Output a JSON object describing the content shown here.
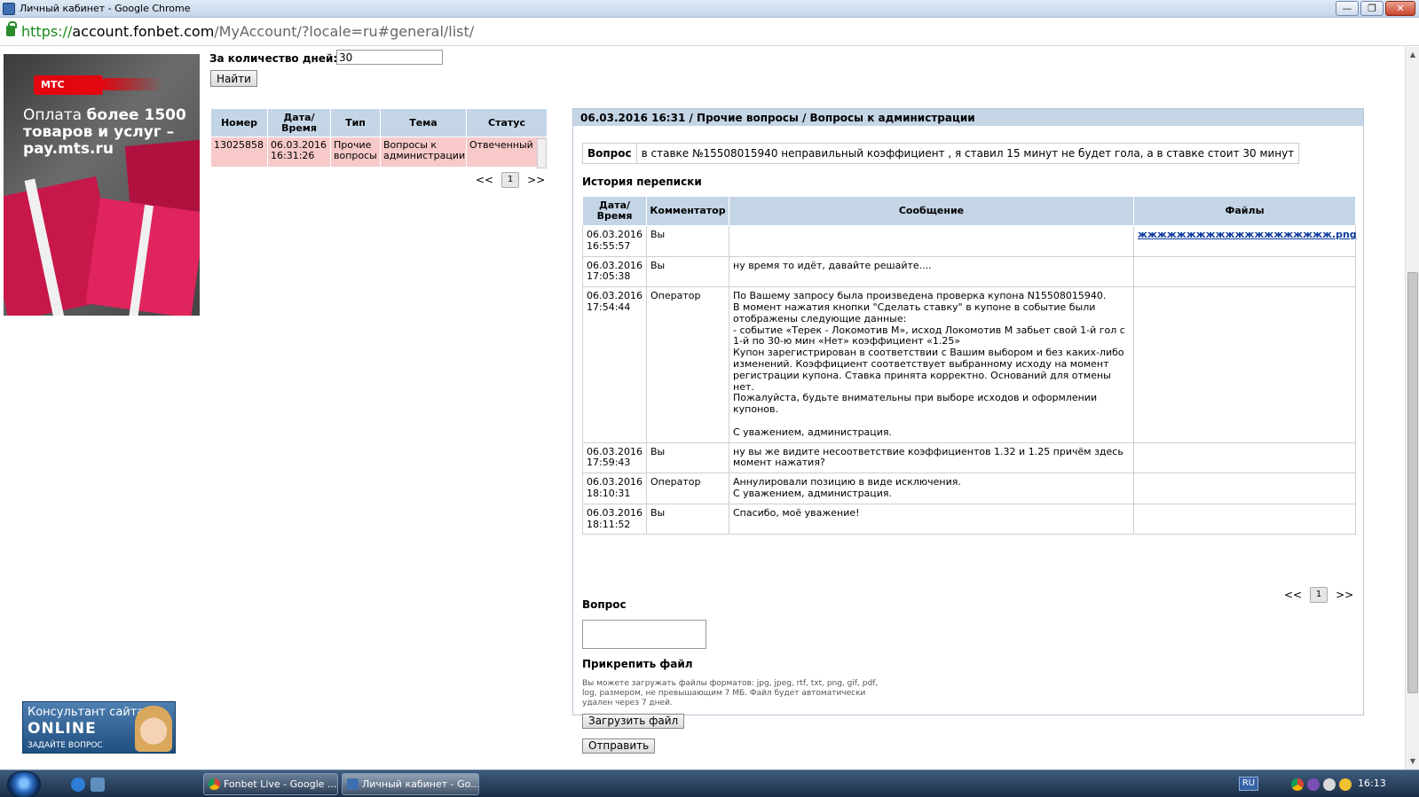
{
  "window": {
    "title": "Личный кабинет - Google Chrome",
    "min_glyph": "—",
    "max_glyph": "❐",
    "close_glyph": "✕"
  },
  "address": {
    "scheme": "https://",
    "host": "account.fonbet.com",
    "path": "/MyAccount/?locale=ru#general/list/"
  },
  "ad": {
    "brand": "МТС",
    "text_prefix": "Оплата ",
    "text_bold": "более 1500 товаров и услуг – pay.mts.ru"
  },
  "consultant": {
    "line1": "Консультант сайта",
    "line2": "ONLINE",
    "line3": "ЗАДАЙТЕ ВОПРОС"
  },
  "filter": {
    "days_label": "За количество дней:",
    "days_value": "30",
    "find_label": "Найти"
  },
  "list": {
    "headers": [
      "Номер",
      "Дата/ Время",
      "Тип",
      "Тема",
      "Статус"
    ],
    "rows": [
      [
        "13025858",
        "06.03.2016 16:31:26",
        "Прочие вопросы",
        "Вопросы к администрации",
        "Отвеченный"
      ]
    ],
    "pager": {
      "prev": "<<",
      "page": "1",
      "next": ">>"
    }
  },
  "detail": {
    "header": "06.03.2016 16:31 / Прочие вопросы / Вопросы к администрации",
    "question_label": "Вопрос",
    "question_text": "в ставке №15508015940 неправильный коэффициент , я ставил 15 минут не будет гола, а в ставке стоит 30 минут",
    "history_title": "История переписки",
    "history_headers": [
      "Дата/ Время",
      "Комментатор",
      "Сообщение",
      "Файлы"
    ],
    "history_rows": [
      {
        "dt": "06.03.2016 16:55:57",
        "who": "Вы",
        "msg": "",
        "file": "жжжжжжжжжжжжжжжжжжжж.png"
      },
      {
        "dt": "06.03.2016 17:05:38",
        "who": "Вы",
        "msg": "ну время то идёт, давайте решайте....",
        "file": ""
      },
      {
        "dt": "06.03.2016 17:54:44",
        "who": "Оператор",
        "msg": "По Вашему запросу была произведена проверка купона N15508015940.\nВ момент нажатия кнопки \"Сделать ставку\" в купоне в событие были отображены следующие данные:\n- событие «Терек - Локомотив М», исход Локомотив М забьет свой 1-й гол с 1-й по 30-ю мин «Нет» коэффициент «1.25»\nКупон зарегистрирован в соответствии с Вашим выбором и без каких-либо изменений. Коэффициент соответствует выбранному исходу на момент регистрации купона. Ставка принята корректно. Оснований для отмены нет.\nПожалуйста, будьте внимательны при выборе исходов и оформлении купонов.\n\nС уважением, администрация.",
        "file": ""
      },
      {
        "dt": "06.03.2016 17:59:43",
        "who": "Вы",
        "msg": "ну вы же видите несоответствие коэффициентов 1.32 и 1.25 причём здесь момент нажатия?",
        "file": ""
      },
      {
        "dt": "06.03.2016 18:10:31",
        "who": "Оператор",
        "msg": "Аннулировали позицию в виде исключения.\nС уважением, администрация.",
        "file": ""
      },
      {
        "dt": "06.03.2016 18:11:52",
        "who": "Вы",
        "msg": "Спасибо, моё уважение!",
        "file": ""
      }
    ],
    "pager": {
      "prev": "<<",
      "page": "1",
      "next": ">>"
    },
    "form": {
      "question_label": "Вопрос",
      "attach_label": "Прикрепить файл",
      "attach_hint": "Вы можете загружать файлы форматов: jpg, jpeg, rtf, txt, png, gif, pdf, log, размером, не превышающим 7 МБ. Файл будет автоматически удален через 7 дней.",
      "upload_label": "Загрузить файл",
      "send_label": "Отправить"
    }
  },
  "taskbar": {
    "tasks": [
      "Fonbet Live - Google ...",
      "Личный кабинет - Go..."
    ],
    "lang": "RU",
    "clock": "16:13"
  },
  "colors": {
    "header_bg": "#c4d5e6",
    "row_highlight": "#f7c9c9",
    "link": "#0b3a9c",
    "secure_green": "#1a8a1a",
    "brand_red": "#e30611"
  }
}
